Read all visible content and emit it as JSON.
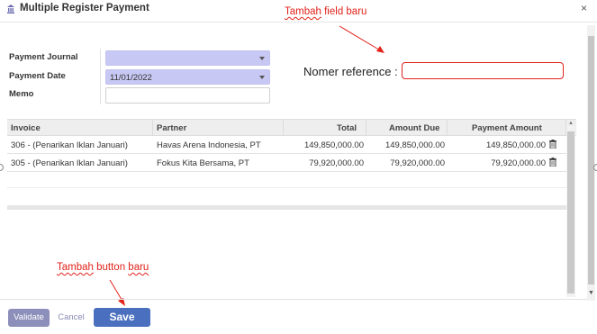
{
  "dialog": {
    "title": "Multiple Register Payment",
    "close_glyph": "×"
  },
  "annotations": {
    "field_note_part1": "Tambah",
    "field_note_part2": " field baru",
    "button_note_part1": "Tambah",
    "button_note_part2": " button ",
    "button_note_part3": "baru",
    "color": "#e2231a"
  },
  "form": {
    "payment_journal_label": "Payment Journal",
    "payment_journal_value": "",
    "payment_date_label": "Payment Date",
    "payment_date_value": "11/01/2022",
    "memo_label": "Memo",
    "memo_value": ""
  },
  "reference": {
    "label": "Nomer reference :",
    "value": ""
  },
  "table": {
    "columns": [
      "Invoice",
      "Partner",
      "Total",
      "Amount Due",
      "Payment Amount"
    ],
    "rows": [
      {
        "invoice": "306 - (Penarikan Iklan Januari)",
        "partner": "Havas Arena Indonesia, PT",
        "total": "149,850,000.00",
        "amount_due": "149,850,000.00",
        "payment_amount": "149,850,000.00"
      },
      {
        "invoice": "305 - (Penarikan Iklan Januari)",
        "partner": "Fokus Kita Bersama, PT",
        "total": "79,920,000.00",
        "amount_due": "79,920,000.00",
        "payment_amount": "79,920,000.00"
      }
    ]
  },
  "footer": {
    "validate_label": "Validate",
    "cancel_label": "Cancel",
    "save_label": "Save"
  },
  "icons": {
    "app": "bank-icon",
    "row_delete": "trash-icon",
    "dropdown": "caret-down-icon"
  },
  "colors": {
    "select_bg": "#c8c8f4",
    "save_button": "#4a6fbf",
    "validate_button": "#8d8fbb",
    "reference_border": "#e2231a"
  }
}
